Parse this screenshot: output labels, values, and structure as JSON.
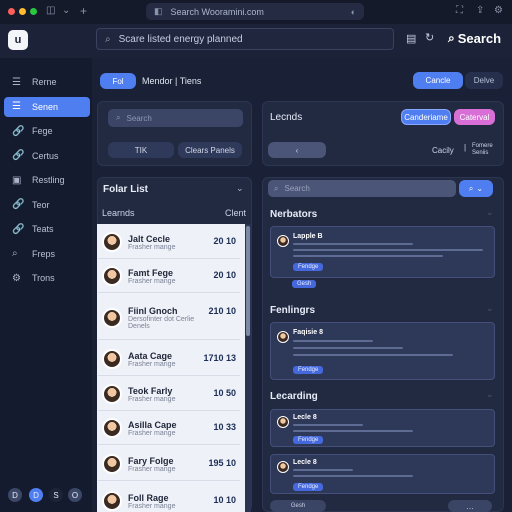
{
  "browser": {
    "url": "Search Wooramini.com",
    "tab_icon": "sidebar-icon",
    "actions": [
      "puzzle-icon",
      "share-icon",
      "settings-icon"
    ]
  },
  "header": {
    "logo": "u",
    "search_placeholder": "Scare listed energy planned",
    "search_label": "Search",
    "icons": [
      "doc-icon",
      "refresh-icon",
      "search-icon"
    ]
  },
  "sidebar": {
    "items": [
      {
        "label": "Rerne",
        "icon": "list-icon",
        "active": false
      },
      {
        "label": "Senen",
        "icon": "list-icon",
        "active": true
      },
      {
        "label": "Fege",
        "icon": "link-icon",
        "active": false
      },
      {
        "label": "Certus",
        "icon": "link-icon",
        "active": false
      },
      {
        "label": "Restling",
        "icon": "calendar-icon",
        "active": false
      },
      {
        "label": "Teor",
        "icon": "link-icon",
        "active": false
      },
      {
        "label": "Teats",
        "icon": "link-icon",
        "active": false
      },
      {
        "label": "Freps",
        "icon": "search-icon",
        "active": false
      },
      {
        "label": "Trons",
        "icon": "gear-icon",
        "active": false
      }
    ],
    "bottom": [
      "D",
      "D",
      "S",
      "O"
    ]
  },
  "toolbar": {
    "pill": "Fol",
    "title": "Mendor | Tiens",
    "btn1": "Cancle",
    "btn2": "Delve"
  },
  "filter_panel": {
    "search": "Search",
    "btn_left": "TIK",
    "btn_right": "Clears Panels"
  },
  "list": {
    "title": "Folar List",
    "col_left": "Learnds",
    "col_right": "Clent",
    "rows": [
      {
        "name": "Jalt Cecle",
        "sub": "Frasher mange",
        "value": "20 10"
      },
      {
        "name": "Famt Fege",
        "sub": "Frasher mange",
        "value": "20 10"
      },
      {
        "name": "Fiinl Gnoch",
        "sub": "Dersofinter dot Cerlie",
        "sub2": "Denels",
        "value": "210 10"
      },
      {
        "name": "Aata Cage",
        "sub": "Frasher mange",
        "value": "1710 13"
      },
      {
        "name": "Teok Farly",
        "sub": "Frasher mange",
        "value": "10 50"
      },
      {
        "name": "Asilla Cape",
        "sub": "Frasher mange",
        "value": "10 33"
      },
      {
        "name": "Fary Folge",
        "sub": "Frasher mange",
        "value": "195 10"
      },
      {
        "name": "Foll Rage",
        "sub": "Frasher mange",
        "value": "10 10"
      }
    ]
  },
  "right_panel": {
    "title": "Lecnds",
    "btn1": "Canderiame",
    "btn2": "Caterval",
    "label": "Cacily",
    "label2": "Fomere Seniis"
  },
  "detail": {
    "search": "Search",
    "sections": [
      {
        "title": "Nerbators",
        "cards": [
          {
            "name": "Lapple B",
            "tag": "Fendge",
            "tag2": "Gesh"
          }
        ]
      },
      {
        "title": "Fenlingrs",
        "cards": [
          {
            "name": "Faqisie 8",
            "tag": "Fendge"
          }
        ]
      },
      {
        "title": "Lecarding",
        "cards": [
          {
            "name": "Lecle 8",
            "tag": "Fendge"
          },
          {
            "name": "Lecle 8",
            "tag": "Fendge",
            "tag2": "Gesh"
          }
        ]
      }
    ]
  },
  "colors": {
    "accent": "#4f7ef0",
    "pink": "#d86ed6",
    "bg": "#1a2035"
  }
}
